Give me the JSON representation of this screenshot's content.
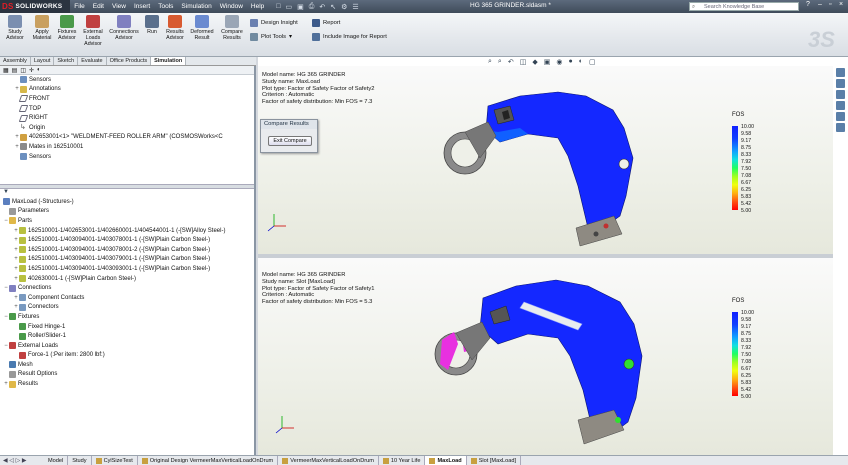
{
  "app": {
    "name": "SOLIDWORKS",
    "logo_mark": "DS",
    "title": "HG 365 GRINDER.sldasm *"
  },
  "menu": [
    "File",
    "Edit",
    "View",
    "Insert",
    "Tools",
    "Simulation",
    "Window",
    "Help"
  ],
  "search": {
    "placeholder": "Search Knowledge Base"
  },
  "ribbon": {
    "buttons": [
      {
        "label": "Study Advisor"
      },
      {
        "label": "Apply Material"
      },
      {
        "label": "Fixtures Advisor"
      },
      {
        "label": "External Loads Advisor"
      },
      {
        "label": "Connections Advisor"
      },
      {
        "label": "Run"
      },
      {
        "label": "Results Advisor"
      },
      {
        "label": "Deformed Result"
      },
      {
        "label": "Compare Results"
      }
    ],
    "design_insight": "Design Insight",
    "plot_tools": "Plot Tools",
    "report": "Report",
    "include_image": "Include Image for Report"
  },
  "cm_tabs": [
    "Assembly",
    "Layout",
    "Sketch",
    "Evaluate",
    "Office Products",
    "Simulation"
  ],
  "feature_tree": {
    "rows": [
      "Sensors",
      "Annotations",
      "FRONT",
      "TOP",
      "RIGHT",
      "Origin",
      "402653001<1> \"WELDMENT-FEED ROLLER ARM\" (COSMOSWorks<C",
      "Mates in 162510001",
      "Sensors"
    ]
  },
  "study_tree": {
    "study": "MaxLoad (-Structures-)",
    "parameters": "Parameters",
    "parts_label": "Parts",
    "parts": [
      "162510001-1/402653001-1/402660001-1/404544001-1 (-[SW]Alloy Steel-)",
      "162510001-1/403094001-1/403078001-1 (-[SW]Plain Carbon Steel-)",
      "162510001-1/403094001-1/403078001-2 (-[SW]Plain Carbon Steel-)",
      "162510001-1/403094001-1/403079001-1 (-[SW]Plain Carbon Steel-)",
      "162510001-1/403094001-1/403093001-1 (-[SW]Plain Carbon Steel-)",
      "402630001-1 (-[SW]Plain Carbon Steel-)"
    ],
    "connections": "Connections",
    "component_contacts": "Component Contacts",
    "connectors": "Connectors",
    "fixtures": "Fixtures",
    "fixed_hinge": "Fixed Hinge-1",
    "roller_slider": "Roller/Slider-1",
    "external_loads": "External Loads",
    "force": "Force-1 (:Per item: 2800 lbf:)",
    "mesh": "Mesh",
    "result_options": "Result Options",
    "results": "Results"
  },
  "compare": {
    "title": "Compare Results",
    "exit_label": "Exit Compare"
  },
  "viewport1": {
    "model": "Model name: HG 365 GRINDER",
    "study": "Study name: MaxLoad",
    "plot": "Plot type: Factor of Safety Factor of Safety2",
    "criterion": "Criterion : Automatic",
    "dist": "Factor of safety distribution: Min FOS = 7.3"
  },
  "viewport2": {
    "model": "Model name: HG 365 GRINDER",
    "study": "Study name: Slot [MaxLoad]",
    "plot": "Plot type: Factor of Safety Factor of Safety1",
    "criterion": "Criterion : Automatic",
    "dist": "Factor of safety distribution: Min FOS = 5.3"
  },
  "legend": {
    "title": "FOS",
    "values": [
      "10.00",
      "9.58",
      "9.17",
      "8.75",
      "8.33",
      "7.92",
      "7.50",
      "7.08",
      "6.67",
      "6.25",
      "5.83",
      "5.42",
      "5.00"
    ]
  },
  "bottom_tabs": [
    "Model",
    "Study",
    "CylSizeTest",
    "Original Design VermeerMaxVerticalLoadOnDrum",
    "VermeerMaxVerticalLoadOnDrum",
    "10 Year Life",
    "MaxLoad",
    "Slot [MaxLoad]"
  ],
  "bottom_active": "MaxLoad",
  "colors": {
    "mesh_blue": "#1428ff",
    "stress_red": "#ff0000",
    "titlebar": "#4a5666"
  }
}
